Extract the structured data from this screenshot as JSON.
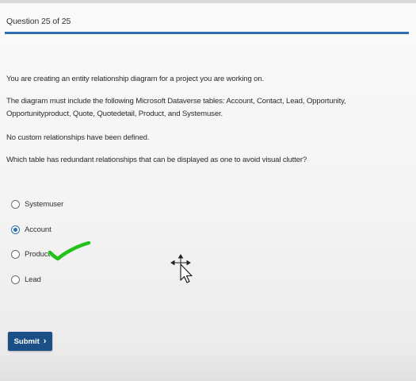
{
  "header": {
    "question_counter": "Question 25 of 25"
  },
  "question": {
    "p1": "You are creating an entity relationship diagram for a project you are working on.",
    "p2": "The diagram must include the following Microsoft Dataverse tables: Account, Contact, Lead, Opportunity, Opportunityproduct, Quote, Quotedetail, Product, and Systemuser.",
    "p3": "No custom relationships have been defined.",
    "p4": "Which table has redundant relationships that can be displayed as one to avoid visual clutter?"
  },
  "options": [
    {
      "label": "Systemuser",
      "selected": false
    },
    {
      "label": "Account",
      "selected": true
    },
    {
      "label": "Product",
      "selected": false
    },
    {
      "label": "Lead",
      "selected": false
    }
  ],
  "submit": {
    "label": "Submit",
    "icon": "chevron-right-icon"
  },
  "colors": {
    "accent": "#2e6fb4",
    "button": "#1b4f85",
    "annotation": "#22c21b"
  }
}
